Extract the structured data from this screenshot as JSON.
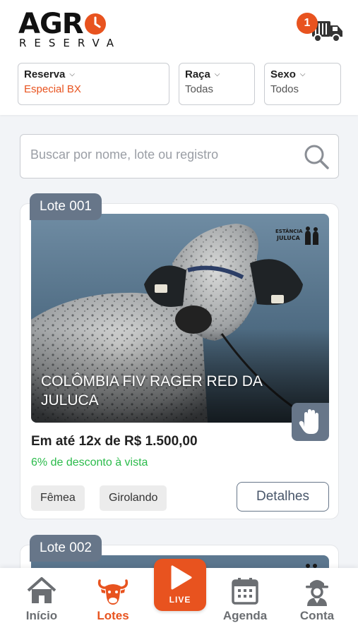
{
  "brand": {
    "line1": "AGR",
    "line2": "RESERVA"
  },
  "cart": {
    "count": "1"
  },
  "filters": [
    {
      "label": "Reserva",
      "value": "Especial BX"
    },
    {
      "label": "Raça",
      "value": "Todas"
    },
    {
      "label": "Sexo",
      "value": "Todos"
    }
  ],
  "search": {
    "placeholder": "Buscar por nome, lote ou registro"
  },
  "lots": [
    {
      "tag": "Lote 001",
      "title": "COLÔMBIA FIV RAGER RED DA JULUCA",
      "brand_mark": "ESTÂNCIA JULUCA",
      "price": "Em até 12x de R$ 1.500,00",
      "discount": "6% de desconto à vista",
      "chips": [
        "Fêmea",
        "Girolando"
      ],
      "details_label": "Detalhes"
    },
    {
      "tag": "Lote 002"
    }
  ],
  "nav": {
    "home": "Início",
    "lots": "Lotes",
    "live": "LIVE",
    "schedule": "Agenda",
    "account": "Conta"
  },
  "colors": {
    "accent": "#e8531f",
    "slate": "#677689",
    "success": "#2bbb4b"
  },
  "icons": [
    "truck-icon",
    "search-icon",
    "hand-icon",
    "home-icon",
    "cow-icon",
    "play-icon",
    "calendar-icon",
    "farmer-icon"
  ]
}
